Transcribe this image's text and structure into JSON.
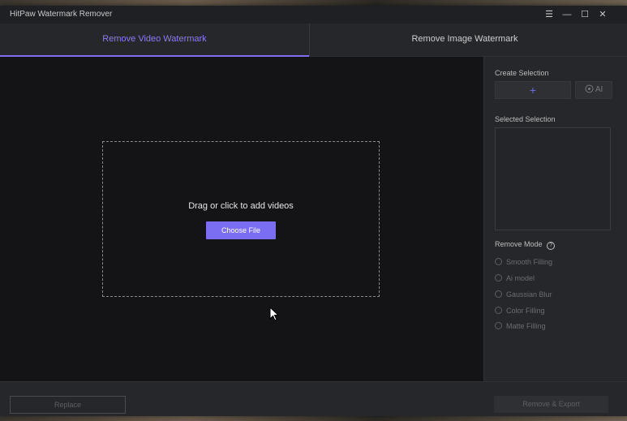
{
  "app": {
    "title": "HitPaw Watermark Remover"
  },
  "window_controls": {
    "menu": "☰",
    "minimize": "—",
    "maximize": "☐",
    "close": "✕"
  },
  "tabs": [
    {
      "label": "Remove Video Watermark",
      "active": true
    },
    {
      "label": "Remove Image Watermark",
      "active": false
    }
  ],
  "dropzone": {
    "text": "Drag or click to add videos",
    "button_label": "Choose File"
  },
  "sidebar": {
    "create_selection_label": "Create Selection",
    "add_selection_icon": "+",
    "ai_label": "AI",
    "selected_selection_label": "Selected Selection",
    "remove_mode_label": "Remove Mode",
    "help_icon": "?",
    "modes": [
      {
        "label": "Smooth Filling"
      },
      {
        "label": "Ai model"
      },
      {
        "label": "Gaussian Blur"
      },
      {
        "label": "Color Filling"
      },
      {
        "label": "Matte Filling"
      }
    ]
  },
  "footer": {
    "replace_label": "Replace",
    "export_label": "Remove & Export"
  },
  "colors": {
    "accent": "#7b6ef2",
    "background": "#141416",
    "panel": "#26272a"
  }
}
